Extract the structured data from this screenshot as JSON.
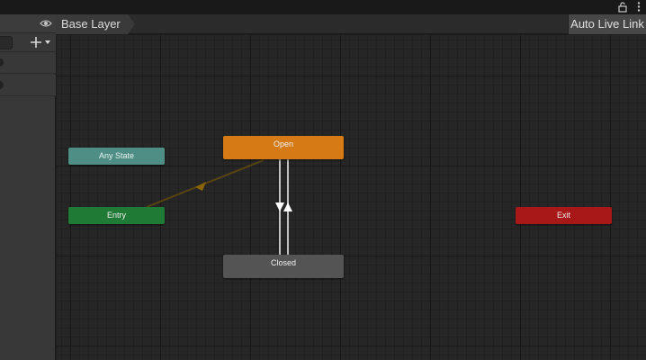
{
  "breadcrumb": {
    "layer": "Base Layer"
  },
  "toolbar": {
    "live_link_label": "Auto Live Link"
  },
  "nodes": {
    "any_state": "Any State",
    "entry": "Entry",
    "exit": "Exit",
    "open": "Open",
    "closed": "Closed"
  },
  "colors": {
    "any_state": "#4e8e85",
    "entry": "#1f7a35",
    "exit": "#a81818",
    "default_state": "#d57a15",
    "state": "#545454",
    "entry_transition": "#5a4410"
  },
  "icons": {
    "lock": "lock-icon",
    "menu": "kebab-menu-icon",
    "visibility": "eye-icon",
    "add": "plus-icon",
    "dropdown": "chevron-down-icon"
  }
}
